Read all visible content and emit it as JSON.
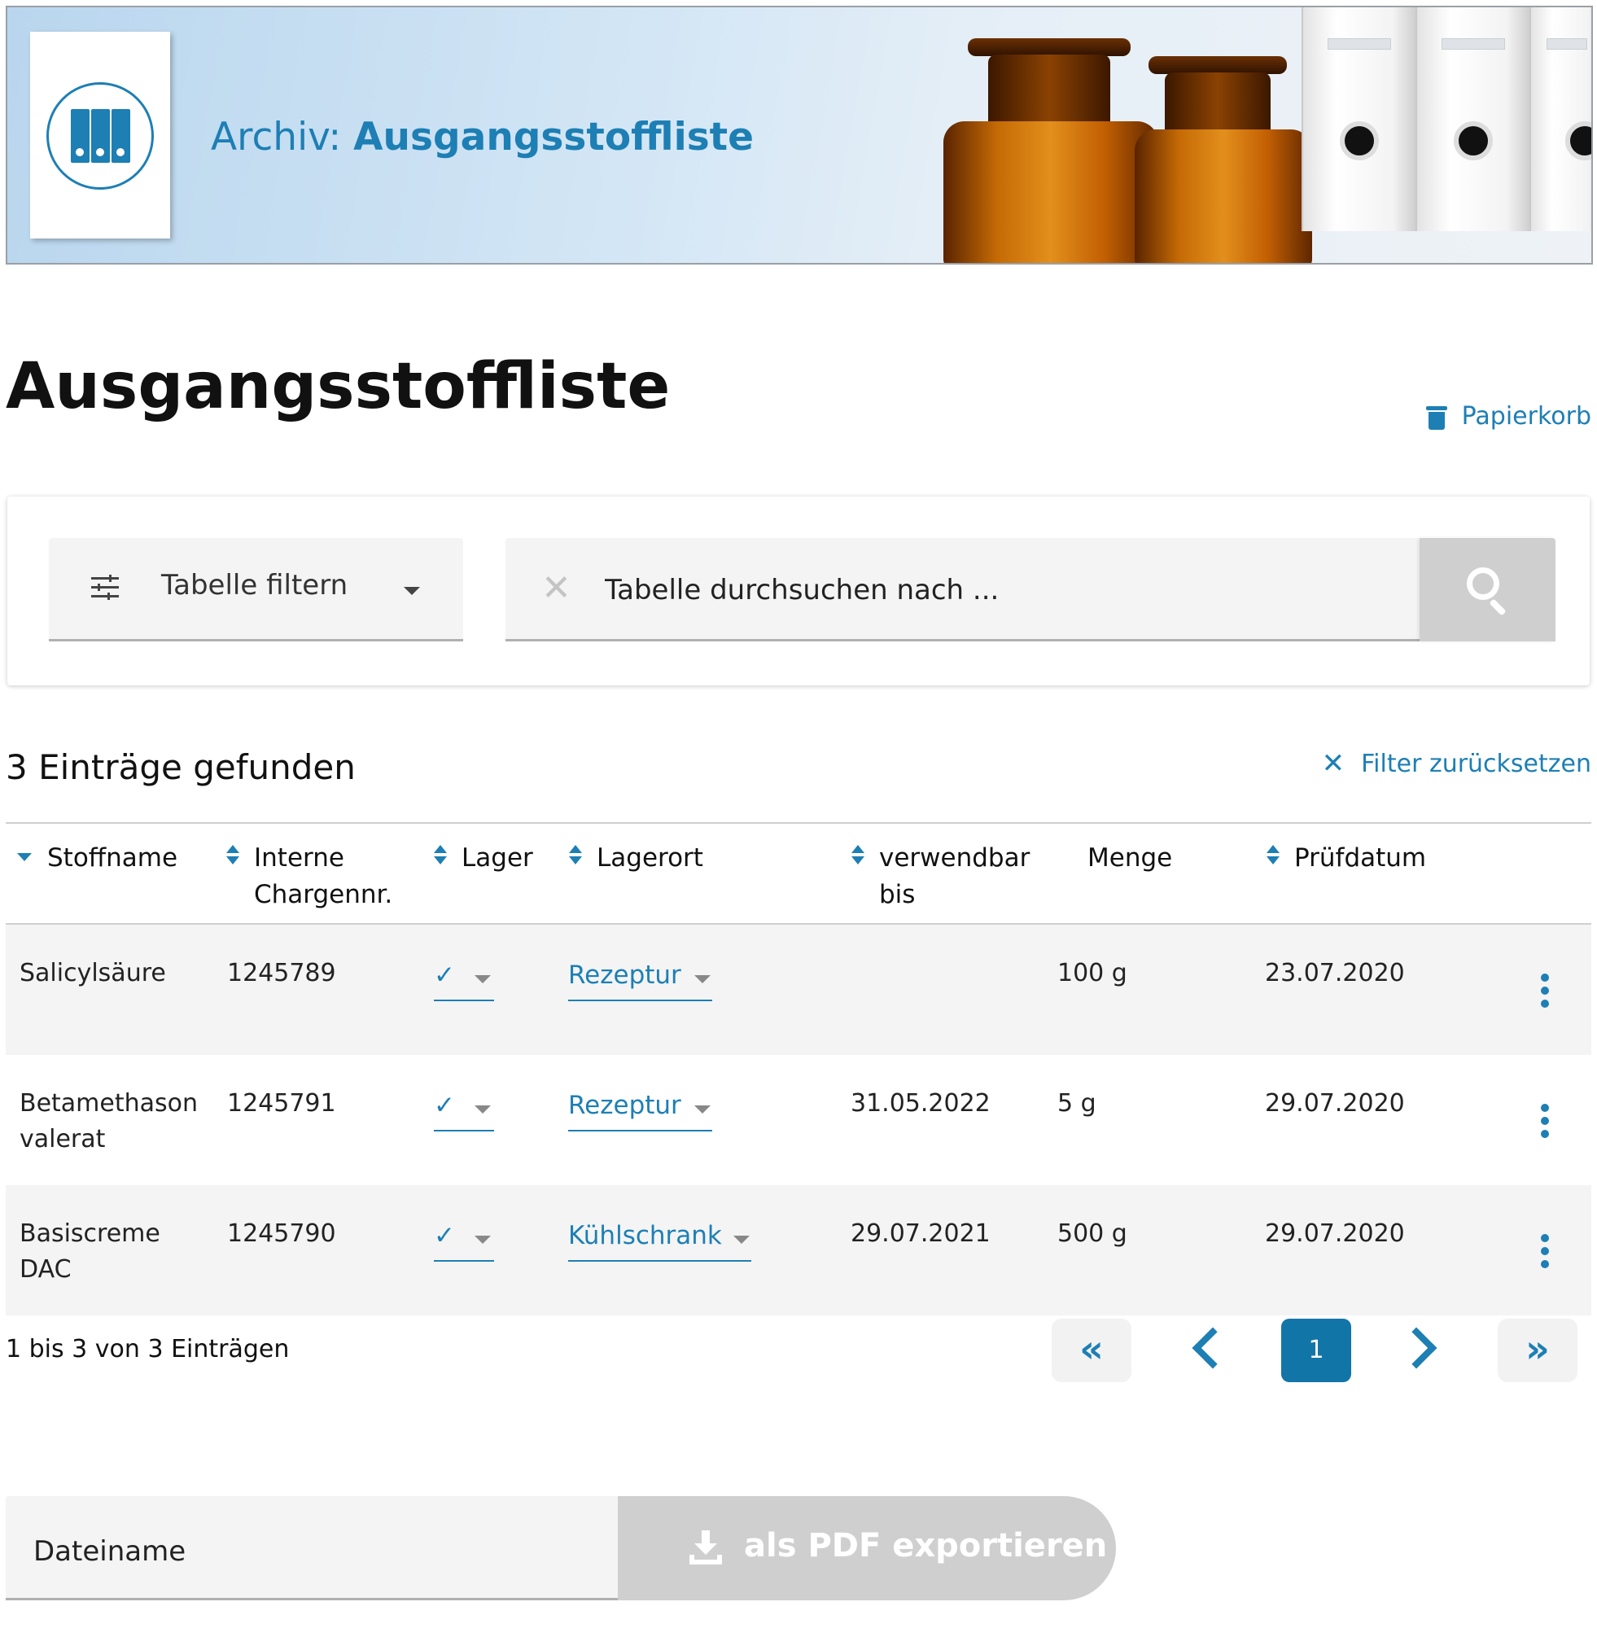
{
  "banner": {
    "title_prefix": "Archiv: ",
    "title_main": "Ausgangsstoffliste",
    "icon": "binder-icon"
  },
  "page": {
    "title": "Ausgangsstoffliste",
    "trash_label": "Papierkorb"
  },
  "filter": {
    "dropdown_label": "Tabelle filtern",
    "search_placeholder": "Tabelle durchsuchen nach ..."
  },
  "results": {
    "count_text": "3 Einträge gefunden",
    "reset_label": "Filter zurücksetzen"
  },
  "table": {
    "columns": [
      {
        "label": "Stoffname",
        "sort": "desc"
      },
      {
        "label": "Interne Chargennr.",
        "sort": "both"
      },
      {
        "label": "Lager",
        "sort": "both"
      },
      {
        "label": "Lagerort",
        "sort": "both"
      },
      {
        "label": "verwendbar bis",
        "sort": "both"
      },
      {
        "label": "Menge",
        "sort": "none"
      },
      {
        "label": "Prüfdatum",
        "sort": "both"
      }
    ],
    "rows": [
      {
        "name": "Salicylsäure",
        "charge": "1245789",
        "lager": "✓",
        "lagerort": "Rezeptur",
        "verwendbar": "",
        "menge": "100 g",
        "pruefdatum": "23.07.2020"
      },
      {
        "name": "Betamethason valerat",
        "charge": "1245791",
        "lager": "✓",
        "lagerort": "Rezeptur",
        "verwendbar": "31.05.2022",
        "menge": "5 g",
        "pruefdatum": "29.07.2020"
      },
      {
        "name": "Basiscreme DAC",
        "charge": "1245790",
        "lager": "✓",
        "lagerort": "Kühlschrank",
        "verwendbar": "29.07.2021",
        "menge": "500 g",
        "pruefdatum": "29.07.2020"
      }
    ]
  },
  "pagination": {
    "info": "1 bis 3 von 3 Einträgen",
    "first": "«",
    "last": "»",
    "current_page": "1"
  },
  "export": {
    "filename_placeholder": "Dateiname",
    "button_label": "als PDF exportieren"
  },
  "colors": {
    "accent": "#1d7fb4",
    "active_page": "#1275a7",
    "disabled_button": "#cfcfcf",
    "row_shade": "#f4f4f4"
  }
}
